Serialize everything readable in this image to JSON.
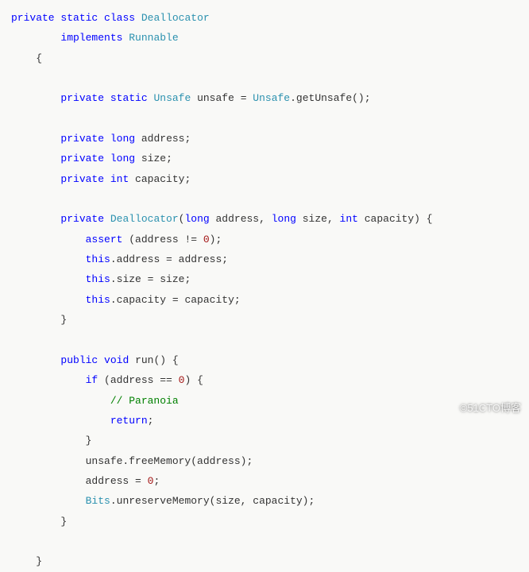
{
  "code": {
    "tokens": [
      {
        "cls": "kw",
        "t": "private"
      },
      {
        "cls": "txt",
        "t": " "
      },
      {
        "cls": "kw",
        "t": "static"
      },
      {
        "cls": "txt",
        "t": " "
      },
      {
        "cls": "kw",
        "t": "class"
      },
      {
        "cls": "txt",
        "t": " "
      },
      {
        "cls": "type",
        "t": "Deallocator"
      },
      {
        "cls": "txt",
        "t": "\n"
      },
      {
        "cls": "txt",
        "t": "        "
      },
      {
        "cls": "kw",
        "t": "implements"
      },
      {
        "cls": "txt",
        "t": " "
      },
      {
        "cls": "type",
        "t": "Runnable"
      },
      {
        "cls": "txt",
        "t": "\n"
      },
      {
        "cls": "txt",
        "t": "    {\n"
      },
      {
        "cls": "txt",
        "t": "\n"
      },
      {
        "cls": "txt",
        "t": "        "
      },
      {
        "cls": "kw",
        "t": "private"
      },
      {
        "cls": "txt",
        "t": " "
      },
      {
        "cls": "kw",
        "t": "static"
      },
      {
        "cls": "txt",
        "t": " "
      },
      {
        "cls": "type",
        "t": "Unsafe"
      },
      {
        "cls": "txt",
        "t": " unsafe = "
      },
      {
        "cls": "type",
        "t": "Unsafe"
      },
      {
        "cls": "txt",
        "t": ".getUnsafe();\n"
      },
      {
        "cls": "txt",
        "t": "\n"
      },
      {
        "cls": "txt",
        "t": "        "
      },
      {
        "cls": "kw",
        "t": "private"
      },
      {
        "cls": "txt",
        "t": " "
      },
      {
        "cls": "kw",
        "t": "long"
      },
      {
        "cls": "txt",
        "t": " address;\n"
      },
      {
        "cls": "txt",
        "t": "        "
      },
      {
        "cls": "kw",
        "t": "private"
      },
      {
        "cls": "txt",
        "t": " "
      },
      {
        "cls": "kw",
        "t": "long"
      },
      {
        "cls": "txt",
        "t": " size;\n"
      },
      {
        "cls": "txt",
        "t": "        "
      },
      {
        "cls": "kw",
        "t": "private"
      },
      {
        "cls": "txt",
        "t": " "
      },
      {
        "cls": "kw",
        "t": "int"
      },
      {
        "cls": "txt",
        "t": " capacity;\n"
      },
      {
        "cls": "txt",
        "t": "\n"
      },
      {
        "cls": "txt",
        "t": "        "
      },
      {
        "cls": "kw",
        "t": "private"
      },
      {
        "cls": "txt",
        "t": " "
      },
      {
        "cls": "type",
        "t": "Deallocator"
      },
      {
        "cls": "txt",
        "t": "("
      },
      {
        "cls": "kw",
        "t": "long"
      },
      {
        "cls": "txt",
        "t": " address, "
      },
      {
        "cls": "kw",
        "t": "long"
      },
      {
        "cls": "txt",
        "t": " size, "
      },
      {
        "cls": "kw",
        "t": "int"
      },
      {
        "cls": "txt",
        "t": " capacity) {\n"
      },
      {
        "cls": "txt",
        "t": "            "
      },
      {
        "cls": "kw",
        "t": "assert"
      },
      {
        "cls": "txt",
        "t": " (address != "
      },
      {
        "cls": "num",
        "t": "0"
      },
      {
        "cls": "txt",
        "t": ");\n"
      },
      {
        "cls": "txt",
        "t": "            "
      },
      {
        "cls": "kw",
        "t": "this"
      },
      {
        "cls": "txt",
        "t": ".address = address;\n"
      },
      {
        "cls": "txt",
        "t": "            "
      },
      {
        "cls": "kw",
        "t": "this"
      },
      {
        "cls": "txt",
        "t": ".size = size;\n"
      },
      {
        "cls": "txt",
        "t": "            "
      },
      {
        "cls": "kw",
        "t": "this"
      },
      {
        "cls": "txt",
        "t": ".capacity = capacity;\n"
      },
      {
        "cls": "txt",
        "t": "        }\n"
      },
      {
        "cls": "txt",
        "t": "\n"
      },
      {
        "cls": "txt",
        "t": "        "
      },
      {
        "cls": "kw",
        "t": "public"
      },
      {
        "cls": "txt",
        "t": " "
      },
      {
        "cls": "kw",
        "t": "void"
      },
      {
        "cls": "txt",
        "t": " run() {\n"
      },
      {
        "cls": "txt",
        "t": "            "
      },
      {
        "cls": "kw",
        "t": "if"
      },
      {
        "cls": "txt",
        "t": " (address == "
      },
      {
        "cls": "num",
        "t": "0"
      },
      {
        "cls": "txt",
        "t": ") {\n"
      },
      {
        "cls": "txt",
        "t": "                "
      },
      {
        "cls": "comment",
        "t": "// Paranoia"
      },
      {
        "cls": "txt",
        "t": "\n"
      },
      {
        "cls": "txt",
        "t": "                "
      },
      {
        "cls": "kw",
        "t": "return"
      },
      {
        "cls": "txt",
        "t": ";\n"
      },
      {
        "cls": "txt",
        "t": "            }\n"
      },
      {
        "cls": "txt",
        "t": "            unsafe.freeMemory(address);\n"
      },
      {
        "cls": "txt",
        "t": "            address = "
      },
      {
        "cls": "num",
        "t": "0"
      },
      {
        "cls": "txt",
        "t": ";\n"
      },
      {
        "cls": "txt",
        "t": "            "
      },
      {
        "cls": "type",
        "t": "Bits"
      },
      {
        "cls": "txt",
        "t": ".unreserveMemory(size, capacity);\n"
      },
      {
        "cls": "txt",
        "t": "        }\n"
      },
      {
        "cls": "txt",
        "t": "\n"
      },
      {
        "cls": "txt",
        "t": "    }"
      }
    ]
  },
  "watermark": "©51CTO博客"
}
